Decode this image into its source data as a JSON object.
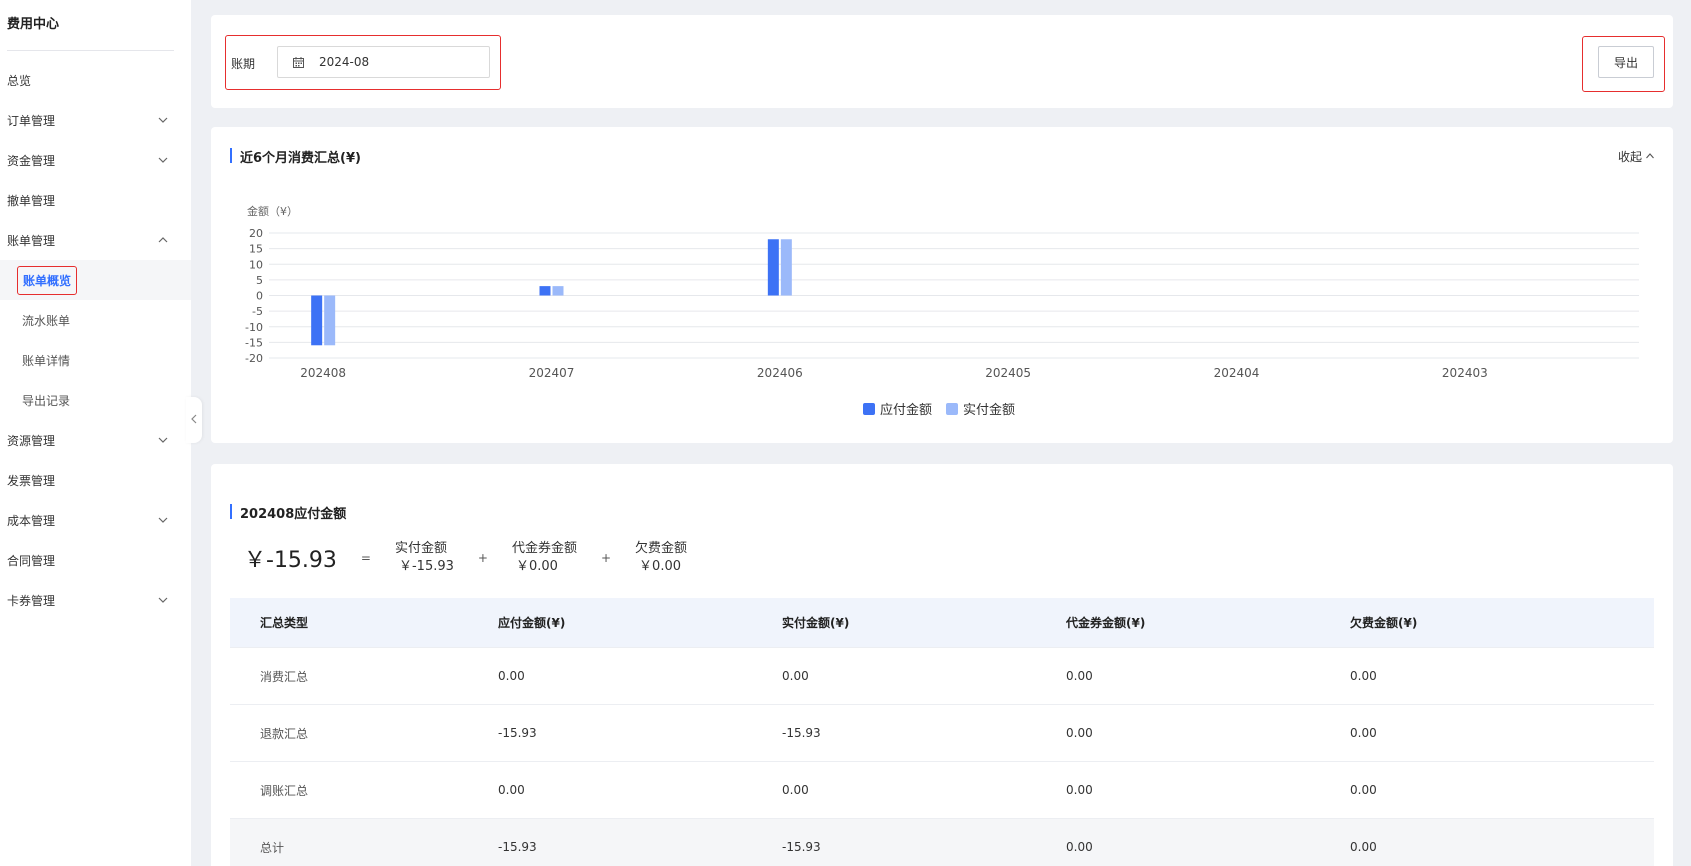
{
  "sidebar": {
    "title": "费用中心",
    "items": [
      {
        "label": "总览",
        "has_chevron": false
      },
      {
        "label": "订单管理",
        "has_chevron": true,
        "expanded": false
      },
      {
        "label": "资金管理",
        "has_chevron": true,
        "expanded": false
      },
      {
        "label": "撤单管理",
        "has_chevron": false
      },
      {
        "label": "账单管理",
        "has_chevron": true,
        "expanded": true
      },
      {
        "label": "账单概览",
        "sub": true,
        "active": true
      },
      {
        "label": "流水账单",
        "sub": true
      },
      {
        "label": "账单详情",
        "sub": true
      },
      {
        "label": "导出记录",
        "sub": true
      },
      {
        "label": "资源管理",
        "has_chevron": true,
        "expanded": false
      },
      {
        "label": "发票管理",
        "has_chevron": false
      },
      {
        "label": "成本管理",
        "has_chevron": true,
        "expanded": false
      },
      {
        "label": "合同管理",
        "has_chevron": false
      },
      {
        "label": "卡券管理",
        "has_chevron": true,
        "expanded": false
      }
    ]
  },
  "filter": {
    "period_label": "账期",
    "period_value": "2024-08",
    "export_label": "导出"
  },
  "summary_chart": {
    "title": "近6个月消费汇总(¥)",
    "collapse_label": "收起"
  },
  "chart_data": {
    "type": "bar",
    "ylabel": "金额（¥）",
    "categories": [
      "202408",
      "202407",
      "202406",
      "202405",
      "202404",
      "202403"
    ],
    "series": [
      {
        "name": "应付金额",
        "values": [
          -15.93,
          3,
          18,
          0,
          0,
          0
        ],
        "color": "#3d72f5"
      },
      {
        "name": "实付金额",
        "values": [
          -15.93,
          3,
          18,
          0,
          0,
          0
        ],
        "color": "#9bb9fa"
      }
    ],
    "ylim": [
      -20,
      20
    ],
    "yticks": [
      20,
      15,
      10,
      5,
      0,
      -5,
      -10,
      -15,
      -20
    ],
    "grid": true,
    "legend": "bottom-center"
  },
  "detail": {
    "title": "202408应付金额",
    "total": "￥-15.93",
    "eq": "=",
    "plus": "+",
    "parts": [
      {
        "label": "实付金额",
        "value": "￥-15.93"
      },
      {
        "label": "代金券金额",
        "value": "￥0.00"
      },
      {
        "label": "欠费金额",
        "value": "￥0.00"
      }
    ],
    "columns": [
      "汇总类型",
      "应付金额(¥)",
      "实付金额(¥)",
      "代金券金额(¥)",
      "欠费金额(¥)"
    ],
    "rows": [
      [
        "消费汇总",
        "0.00",
        "0.00",
        "0.00",
        "0.00"
      ],
      [
        "退款汇总",
        "-15.93",
        "-15.93",
        "0.00",
        "0.00"
      ],
      [
        "调账汇总",
        "0.00",
        "0.00",
        "0.00",
        "0.00"
      ],
      [
        "总计",
        "-15.93",
        "-15.93",
        "0.00",
        "0.00"
      ]
    ]
  }
}
